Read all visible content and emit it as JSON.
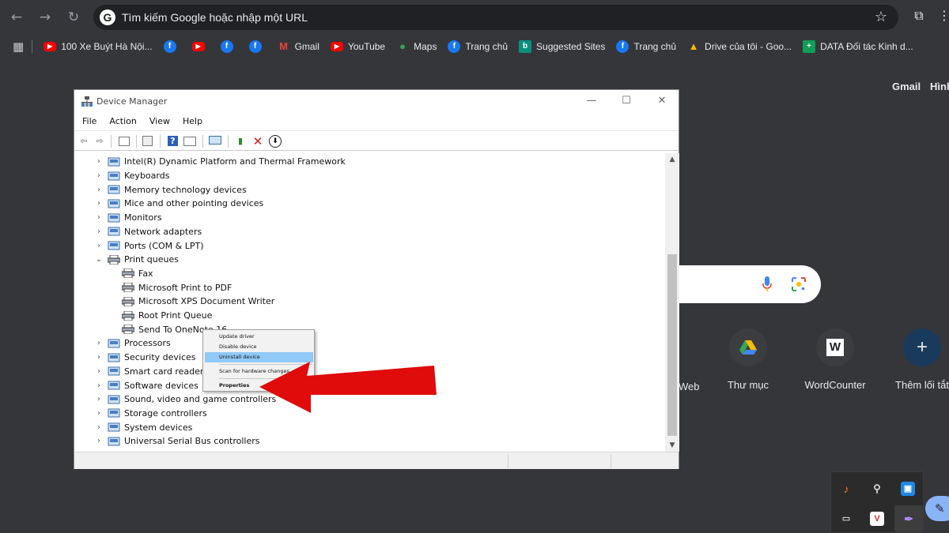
{
  "browser": {
    "omnibox_placeholder": "Tìm kiếm Google hoặc nhập một URL",
    "omnibox_g": "G",
    "bookmarks": [
      {
        "label": "100 Xe Buýt Hà Nội...",
        "icon": "youtube-icon"
      },
      {
        "label": "",
        "icon": "facebook-icon"
      },
      {
        "label": "",
        "icon": "youtube-icon"
      },
      {
        "label": "",
        "icon": "facebook-icon"
      },
      {
        "label": "",
        "icon": "facebook-icon"
      },
      {
        "label": "Gmail",
        "icon": "gmail-icon"
      },
      {
        "label": "YouTube",
        "icon": "youtube-icon"
      },
      {
        "label": "Maps",
        "icon": "maps-icon"
      },
      {
        "label": "Trang chủ",
        "icon": "facebook-icon"
      },
      {
        "label": "Suggested Sites",
        "icon": "bing-icon"
      },
      {
        "label": "Trang chủ",
        "icon": "facebook-icon"
      },
      {
        "label": "Drive của tôi - Goo...",
        "icon": "drive-icon"
      },
      {
        "label": "DATA Đối tác Kinh d...",
        "icon": "sheets-icon"
      }
    ]
  },
  "ntp": {
    "gmail": "Gmail",
    "images": "Hình",
    "shortcuts": [
      {
        "label": "Web",
        "glyph": ""
      },
      {
        "label": "Thư mục",
        "glyph": ""
      },
      {
        "label": "WordCounter",
        "glyph": "W"
      },
      {
        "label": "Thêm lối tắt",
        "glyph": "+"
      }
    ]
  },
  "device_manager": {
    "title": "Device Manager",
    "menu": [
      "File",
      "Action",
      "View",
      "Help"
    ],
    "tree": [
      {
        "label": "Intel(R) Dynamic Platform and Thermal Framework",
        "level": 0,
        "expanded": false
      },
      {
        "label": "Keyboards",
        "level": 0,
        "expanded": false
      },
      {
        "label": "Memory technology devices",
        "level": 0,
        "expanded": false
      },
      {
        "label": "Mice and other pointing devices",
        "level": 0,
        "expanded": false
      },
      {
        "label": "Monitors",
        "level": 0,
        "expanded": false
      },
      {
        "label": "Network adapters",
        "level": 0,
        "expanded": false
      },
      {
        "label": "Ports (COM & LPT)",
        "level": 0,
        "expanded": false
      },
      {
        "label": "Print queues",
        "level": 0,
        "expanded": true
      },
      {
        "label": "Fax",
        "level": 1
      },
      {
        "label": "Microsoft Print to PDF",
        "level": 1
      },
      {
        "label": "Microsoft XPS Document Writer",
        "level": 1
      },
      {
        "label": "Root Print Queue",
        "level": 1
      },
      {
        "label": "Send To OneNote 16",
        "level": 1
      },
      {
        "label": "Processors",
        "level": 0,
        "expanded": false
      },
      {
        "label": "Security devices",
        "level": 0,
        "expanded": false
      },
      {
        "label": "Smart card readers",
        "level": 0,
        "expanded": false
      },
      {
        "label": "Software devices",
        "level": 0,
        "expanded": false
      },
      {
        "label": "Sound, video and game controllers",
        "level": 0,
        "expanded": false
      },
      {
        "label": "Storage controllers",
        "level": 0,
        "expanded": false
      },
      {
        "label": "System devices",
        "level": 0,
        "expanded": false
      },
      {
        "label": "Universal Serial Bus controllers",
        "level": 0,
        "expanded": false
      }
    ],
    "context_menu": {
      "update": "Update driver",
      "disable": "Disable device",
      "uninstall": "Uninstall device",
      "scan": "Scan for hardware changes",
      "properties": "Properties"
    }
  },
  "colors": {
    "annotation_arrow": "#e00b0b",
    "highlight": "#91c9f7",
    "background": "#35363a"
  }
}
